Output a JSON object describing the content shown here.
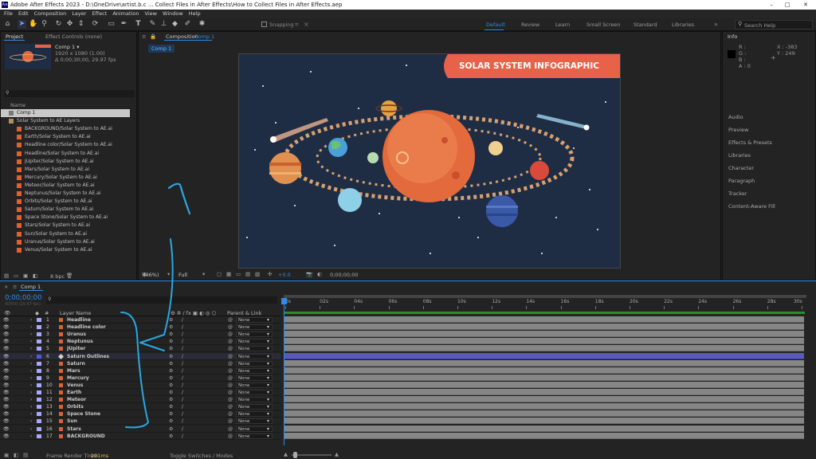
{
  "app": {
    "title": "Adobe After Effects 2023 - D:\\OneDrive\\artist.b.c ... Collect Files in After Effects\\How to Collect Files in After Effects.aep",
    "logo": "Ae",
    "window_controls": [
      "–",
      "□",
      "✕"
    ]
  },
  "menu": [
    "File",
    "Edit",
    "Composition",
    "Layer",
    "Effect",
    "Animation",
    "View",
    "Window",
    "Help"
  ],
  "toolbar": {
    "snapping_label": "Snapping",
    "workspaces": [
      "Default",
      "Review",
      "Learn",
      "Small Screen",
      "Standard",
      "Libraries"
    ],
    "active_workspace": "Default",
    "search_placeholder": "Search Help",
    "tools": [
      "home",
      "selection",
      "hand",
      "zoom",
      "orbit",
      "pan",
      "dolly",
      "rotate",
      "rect",
      "pen",
      "type",
      "brush",
      "clone",
      "eraser",
      "roto",
      "puppet"
    ]
  },
  "project_panel": {
    "tab_label": "Project",
    "effect_controls_label": "Effect Controls (none)",
    "comp_name": "Comp 1 ▾",
    "comp_info1": "1920 x 1080 (1.00)",
    "comp_info2": "Δ 0;00;30;00, 29.97 fps",
    "name_header": "Name",
    "items": [
      {
        "label": "Comp 1",
        "type": "comp"
      },
      {
        "label": "Solar System to AE Layers",
        "type": "folder"
      },
      {
        "label": "BACKGROUND/Solar System to AE.ai",
        "type": "file"
      },
      {
        "label": "Earth/Solar System to AE.ai",
        "type": "file"
      },
      {
        "label": "Headline color/Solar System to AE.ai",
        "type": "file"
      },
      {
        "label": "Headline/Solar System to AE.ai",
        "type": "file"
      },
      {
        "label": "JUpiter/Solar System to AE.ai",
        "type": "file"
      },
      {
        "label": "Mars/Solar System to AE.ai",
        "type": "file"
      },
      {
        "label": "Mercury/Solar System to AE.ai",
        "type": "file"
      },
      {
        "label": "Meteor/Solar System to AE.ai",
        "type": "file"
      },
      {
        "label": "Neptunus/Solar System to AE.ai",
        "type": "file"
      },
      {
        "label": "Orbits/Solar System to AE.ai",
        "type": "file"
      },
      {
        "label": "Saturn/Solar System to AE.ai",
        "type": "file"
      },
      {
        "label": "Space Stone/Solar System to AE.ai",
        "type": "file"
      },
      {
        "label": "Stars/Solar System to AE.ai",
        "type": "file"
      },
      {
        "label": "Sun/Solar System to AE.ai",
        "type": "file"
      },
      {
        "label": "Uranus/Solar System to AE.ai",
        "type": "file"
      },
      {
        "label": "Venus/Solar System to AE.ai",
        "type": "file"
      }
    ],
    "bpc": "8 bpc"
  },
  "composition_panel": {
    "tab_label": "Composition",
    "comp_link": "Comp 1",
    "breadcrumb": "Comp 1",
    "infographic_title": "SOLAR SYSTEM INFOGRAPHIC",
    "zoom": "(46%)",
    "resolution": "Full",
    "exposure": "+0.0",
    "timecode": "0;00;00;00"
  },
  "info_panel": {
    "title": "Info",
    "channels": [
      "R :",
      "G :",
      "B :",
      "A : 0"
    ],
    "x": "X : -383",
    "y": "Y : 249",
    "sections": [
      "Audio",
      "Preview",
      "Effects & Presets",
      "Libraries",
      "Character",
      "Paragraph",
      "Tracker",
      "Content-Aware Fill"
    ]
  },
  "timeline": {
    "tab_label": "Comp 1",
    "timecode": "0;00;00;00",
    "sub_timecode": "00000 (29.97 fps)",
    "layer_name_header": "Layer Name",
    "parent_header": "Parent & Link",
    "ruler": [
      "0s",
      "02s",
      "04s",
      "06s",
      "08s",
      "10s",
      "12s",
      "14s",
      "16s",
      "18s",
      "20s",
      "22s",
      "24s",
      "26s",
      "28s",
      "30s"
    ],
    "layers": [
      {
        "num": "1",
        "name": "Headline",
        "parent": "None",
        "color": "#a8a8ff",
        "type": "ai"
      },
      {
        "num": "2",
        "name": "Headline color",
        "parent": "None",
        "color": "#a8a8ff",
        "type": "ai"
      },
      {
        "num": "3",
        "name": "Uranus",
        "parent": "None",
        "color": "#a8a8ff",
        "type": "ai"
      },
      {
        "num": "4",
        "name": "Neptunus",
        "parent": "None",
        "color": "#a8a8ff",
        "type": "ai"
      },
      {
        "num": "5",
        "name": "JUpiter",
        "parent": "None",
        "color": "#a8a8ff",
        "type": "ai"
      },
      {
        "num": "6",
        "name": "Saturn Outlines",
        "parent": "None",
        "color": "#4a5ad8",
        "type": "shape"
      },
      {
        "num": "7",
        "name": "Saturn",
        "parent": "None",
        "color": "#a8a8ff",
        "type": "ai"
      },
      {
        "num": "8",
        "name": "Mars",
        "parent": "None",
        "color": "#a8a8ff",
        "type": "ai"
      },
      {
        "num": "9",
        "name": "Mercury",
        "parent": "None",
        "color": "#a8a8ff",
        "type": "ai"
      },
      {
        "num": "10",
        "name": "Venus",
        "parent": "None",
        "color": "#a8a8ff",
        "type": "ai"
      },
      {
        "num": "11",
        "name": "Earth",
        "parent": "None",
        "color": "#a8a8ff",
        "type": "ai"
      },
      {
        "num": "12",
        "name": "Meteor",
        "parent": "None",
        "color": "#a8a8ff",
        "type": "ai"
      },
      {
        "num": "13",
        "name": "Orbits",
        "parent": "None",
        "color": "#a8a8ff",
        "type": "ai"
      },
      {
        "num": "14",
        "name": "Space Stone",
        "parent": "None",
        "color": "#a8a8ff",
        "type": "ai"
      },
      {
        "num": "15",
        "name": "Sun",
        "parent": "None",
        "color": "#a8a8ff",
        "type": "ai"
      },
      {
        "num": "16",
        "name": "Stars",
        "parent": "None",
        "color": "#a8a8ff",
        "type": "ai"
      },
      {
        "num": "17",
        "name": "BACKGROUND",
        "parent": "None",
        "color": "#a8a8ff",
        "type": "ai"
      }
    ],
    "frame_render_label": "Frame Render Time:",
    "frame_render_value": "201ms",
    "toggle_label": "Toggle Switches / Modes"
  },
  "annotation": {
    "number": "1",
    "color": "#29a8e0"
  },
  "colors": {
    "accent": "#2d8ceb",
    "infographic_bg": "#1f2d44",
    "banner": "#e8624a"
  }
}
